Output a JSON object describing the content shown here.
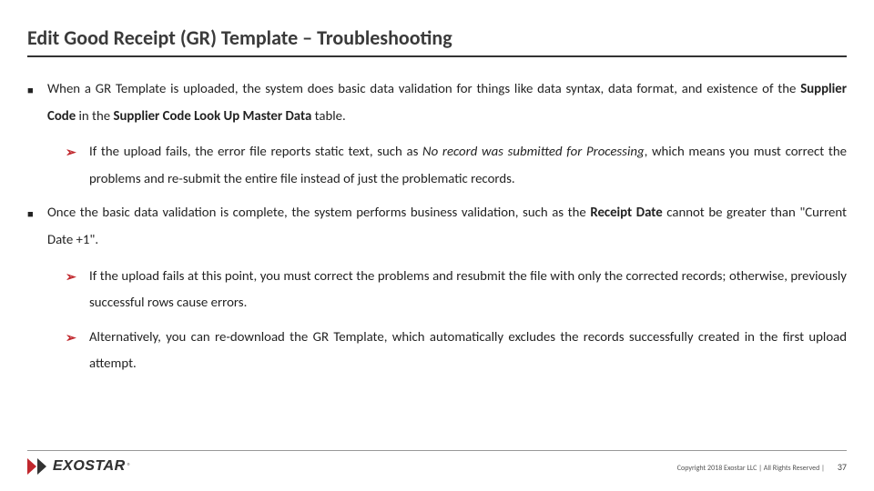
{
  "title": "Edit Good Receipt (GR) Template – Troubleshooting",
  "b1_pre": "When a GR Template is uploaded, the system does basic data validation for things like data syntax, data format, and existence of the ",
  "b1_bold1": "Supplier Code",
  "b1_mid": " in the ",
  "b1_bold2": "Supplier Code Look Up Master Data",
  "b1_post": " table.",
  "b1s1_pre": "If the upload fails, the error file reports static text, such as ",
  "b1s1_italic": "No record was submitted for Processing",
  "b1s1_post": ", which means you must correct the problems and re-submit the entire file instead of just the problematic records.",
  "b2_pre": "Once the basic data validation is complete, the system performs business validation, such as the ",
  "b2_bold": "Receipt Date",
  "b2_post": " cannot be greater than \"Current Date +1\".",
  "b2s1": "If the upload fails at this point, you must correct the problems and resubmit the file with only the corrected records; otherwise, previously successful rows cause errors.",
  "b2s2": "Alternatively, you can re-download the GR Template, which automatically excludes the records successfully created in the first upload attempt.",
  "logo_text": "EXOSTAR",
  "logo_reg": "®",
  "copyright": "Copyright 2018 Exostar LLC | All Rights Reserved |",
  "page": "37"
}
